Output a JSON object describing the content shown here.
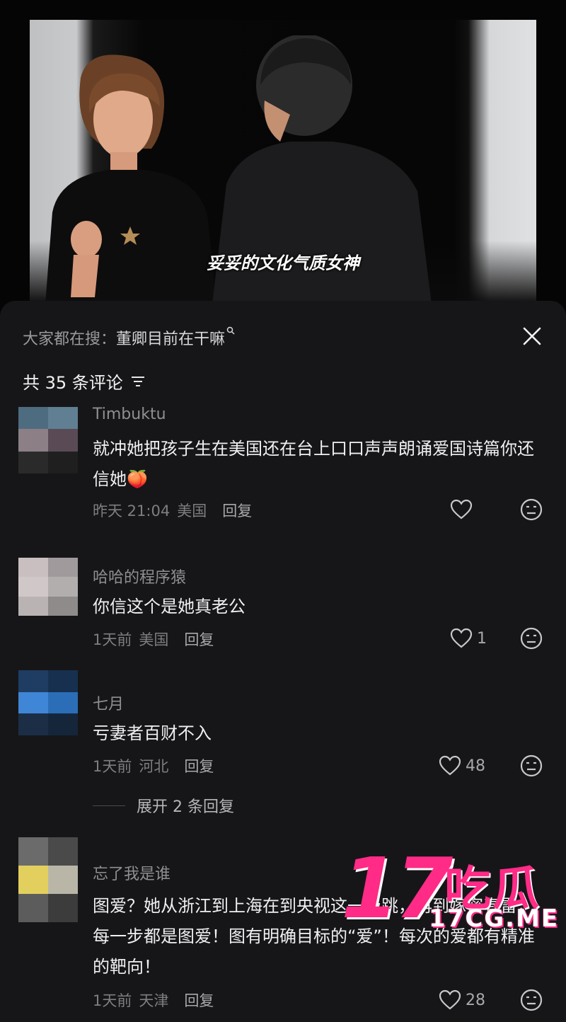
{
  "video": {
    "subtitle": "妥妥的文化气质女神"
  },
  "sheet": {
    "search_prefix": "大家都在搜：",
    "search_query": "董卿目前在干嘛",
    "comment_count_label": "共 35 条评论"
  },
  "comments": [
    {
      "name": "Timbuktu",
      "text": "就冲她把孩子生在美国还在台上口口声声朗诵爱国诗篇你还信她",
      "emoji": "🍑",
      "time": "昨天 21:04",
      "location": "美国",
      "reply_label": "回复",
      "likes": "",
      "avatar_colors": [
        "#4e6c80",
        "#607f92",
        "#8c7f86",
        "#5a4a56",
        "#2a2a2a",
        "#1f1f1f"
      ]
    },
    {
      "name": "哈哈的程序猿",
      "text": "你信这个是她真老公",
      "time": "1天前",
      "location": "美国",
      "reply_label": "回复",
      "likes": "1",
      "avatar_colors": [
        "#c9bfc1",
        "#a09a9c",
        "#d0c8c8",
        "#b3aeae",
        "#b9b3b3",
        "#8f8b8b"
      ]
    },
    {
      "name": "七月",
      "text": "亏妻者百财不入",
      "time": "1天前",
      "location": "河北",
      "reply_label": "回复",
      "likes": "48",
      "avatar_colors": [
        "#1f3d63",
        "#17304f",
        "#3f86d6",
        "#2b6db7",
        "#1b2e45",
        "#15263b"
      ]
    },
    {
      "name": "忘了我是谁",
      "text": "图爱？她从浙江到上海在到央视这一级跳，再到嫁密春雷，每一步都是图爱！图有明确目标的“爱”！每次的爱都有精准的靶向！",
      "time": "1天前",
      "location": "天津",
      "reply_label": "回复",
      "likes": "28",
      "avatar_colors": [
        "#6b6b6b",
        "#4a4a4a",
        "#e3cf5e",
        "#b9b6a8",
        "#5c5c5c",
        "#3c3c3c"
      ]
    }
  ],
  "expand_replies_label": "展开 2 条回复",
  "watermark": {
    "number": "17",
    "chinese": "吃瓜",
    "url": "17CG.ME"
  },
  "colors": {
    "sheet_bg": "#161618",
    "watermark_pink": "#ff2b86"
  }
}
